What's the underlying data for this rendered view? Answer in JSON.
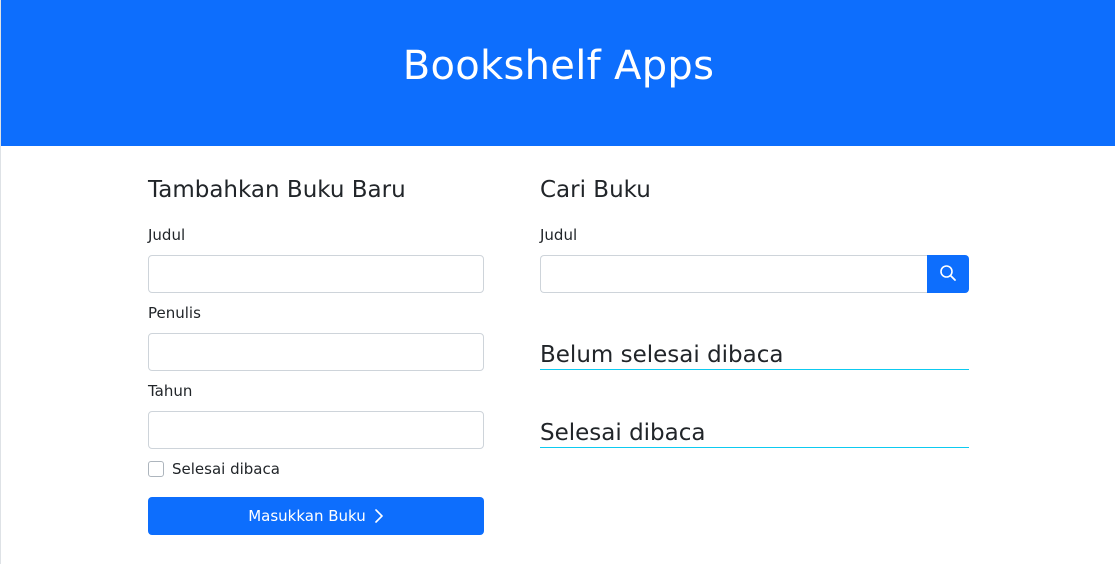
{
  "header": {
    "title": "Bookshelf Apps"
  },
  "add_form": {
    "title": "Tambahkan Buku Baru",
    "title_label": "Judul",
    "title_value": "",
    "author_label": "Penulis",
    "author_value": "",
    "year_label": "Tahun",
    "year_value": "",
    "complete_label": "Selesai dibaca",
    "complete_checked": false,
    "submit_label": "Masukkan Buku",
    "submit_icon": "chevron-right-icon"
  },
  "search_form": {
    "title": "Cari Buku",
    "title_label": "Judul",
    "title_value": "",
    "search_icon": "search-icon"
  },
  "shelves": {
    "incomplete_title": "Belum selesai dibaca",
    "complete_title": "Selesai dibaca"
  },
  "colors": {
    "primary": "#0d6efd",
    "shelf_underline": "#0dcaf0",
    "text": "#212529"
  }
}
